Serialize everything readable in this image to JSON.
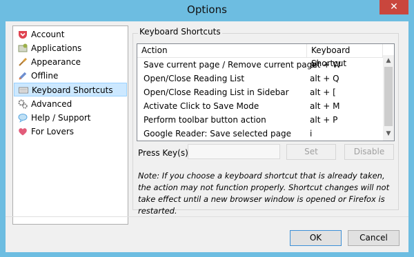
{
  "window": {
    "title": "Options",
    "close_glyph": "✕"
  },
  "sidebar": {
    "items": [
      {
        "label": "Account",
        "icon": "pocket-icon",
        "color": "#e04350"
      },
      {
        "label": "Applications",
        "icon": "applications-icon",
        "color": "#9cb04a"
      },
      {
        "label": "Appearance",
        "icon": "brush-icon",
        "color": "#d89b3b"
      },
      {
        "label": "Offline",
        "icon": "rocket-icon",
        "color": "#6f8fd0"
      },
      {
        "label": "Keyboard Shortcuts",
        "icon": "keyboard-icon",
        "color": "#8a8a8a",
        "selected": true
      },
      {
        "label": "Advanced",
        "icon": "gears-icon",
        "color": "#7a7a7a"
      },
      {
        "label": "Help / Support",
        "icon": "speech-bubble-icon",
        "color": "#5aa7e0"
      },
      {
        "label": "For Lovers",
        "icon": "heart-icon",
        "color": "#e25c7a"
      }
    ]
  },
  "shortcuts": {
    "group_title": "Keyboard Shortcuts",
    "columns": [
      "Action",
      "Keyboard Shortcut"
    ],
    "rows": [
      {
        "action": "Save current page / Remove current page",
        "key": "alt + W"
      },
      {
        "action": "Open/Close Reading List",
        "key": "alt + Q"
      },
      {
        "action": "Open/Close Reading List in Sidebar",
        "key": "alt + ["
      },
      {
        "action": "Activate Click to Save Mode",
        "key": "alt + M"
      },
      {
        "action": "Perform toolbar button action",
        "key": "alt + P"
      },
      {
        "action": "Google Reader: Save selected page",
        "key": "i"
      }
    ],
    "press_keys_label": "Press Key(s):",
    "press_keys_value": "",
    "set_label": "Set",
    "disable_label": "Disable",
    "note": "Note: If you choose a keyboard shortcut that is already taken, the action may not function properly. Shortcut changes will not take effect until a new browser window is opened or Firefox is restarted."
  },
  "footer": {
    "ok_label": "OK",
    "cancel_label": "Cancel"
  },
  "colors": {
    "titlebar": "#6dbde1",
    "selection": "#cce8ff",
    "close": "#c9463d"
  }
}
